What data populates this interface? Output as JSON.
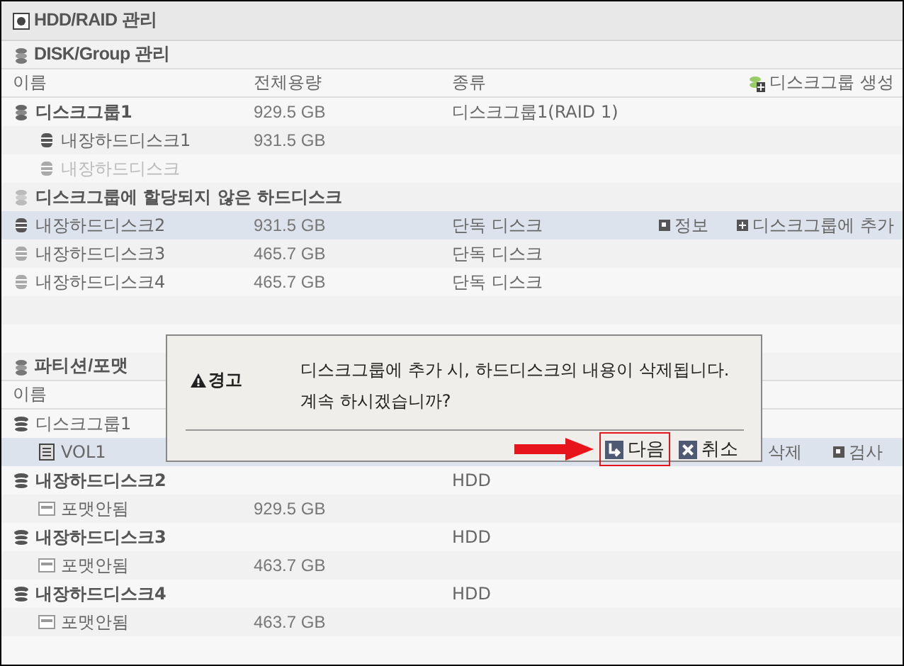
{
  "window": {
    "title": "HDD/RAID 관리"
  },
  "disk_group": {
    "title": "DISK/Group 관리",
    "columns": [
      "이름",
      "전체용량",
      "종류"
    ],
    "create_action": "디스크그룹 생성",
    "rows": [
      {
        "kind": "group",
        "name": "디스크그룹1",
        "capacity": "929.5 GB",
        "type": "디스크그룹1(RAID 1)"
      },
      {
        "kind": "member",
        "name": "내장하드디스크1",
        "capacity": "931.5 GB",
        "disabled": false
      },
      {
        "kind": "member",
        "name": "내장하드디스크",
        "disabled": true
      },
      {
        "kind": "heading",
        "name": "디스크그룹에 할당되지 않은 하드디스크"
      },
      {
        "kind": "disk",
        "name": "내장하드디스크2",
        "capacity": "931.5 GB",
        "type": "단독 디스크",
        "selected": true,
        "actions": [
          {
            "kind": "info",
            "label": "정보"
          },
          {
            "kind": "add",
            "label": "디스크그룹에 추가"
          }
        ]
      },
      {
        "kind": "disk",
        "name": "내장하드디스크3",
        "capacity": "465.7 GB",
        "type": "단독 디스크",
        "selected": false
      },
      {
        "kind": "disk",
        "name": "내장하드디스크4",
        "capacity": "465.7 GB",
        "type": "단독 디스크",
        "selected": false
      }
    ]
  },
  "partition": {
    "title": "파티션/포맷",
    "columns": [
      "이름"
    ],
    "rows": [
      {
        "kind": "group",
        "name": "디스크그룹1"
      },
      {
        "kind": "volume",
        "name": "VOL1",
        "selected": true,
        "actions": [
          {
            "kind": "delete",
            "label": "삭제"
          },
          {
            "kind": "check",
            "label": "검사"
          }
        ]
      },
      {
        "kind": "disk",
        "name": "내장하드디스크2",
        "type": "HDD"
      },
      {
        "kind": "unformatted",
        "name": "포맷안됨",
        "capacity": "929.5 GB"
      },
      {
        "kind": "disk",
        "name": "내장하드디스크3",
        "type": "HDD"
      },
      {
        "kind": "unformatted",
        "name": "포맷안됨",
        "capacity": "463.7 GB"
      },
      {
        "kind": "disk",
        "name": "내장하드디스크4",
        "type": "HDD"
      },
      {
        "kind": "unformatted",
        "name": "포맷안됨",
        "capacity": "463.7 GB"
      }
    ]
  },
  "dialog": {
    "label": "경고",
    "message": "디스크그룹에 추가 시, 하드디스크의 내용이 삭제됩니다.\n계속 하시겠습니까?",
    "buttons": [
      {
        "kind": "next",
        "label": "다음",
        "highlighted": true
      },
      {
        "kind": "cancel",
        "label": "취소",
        "highlighted": false
      }
    ]
  }
}
